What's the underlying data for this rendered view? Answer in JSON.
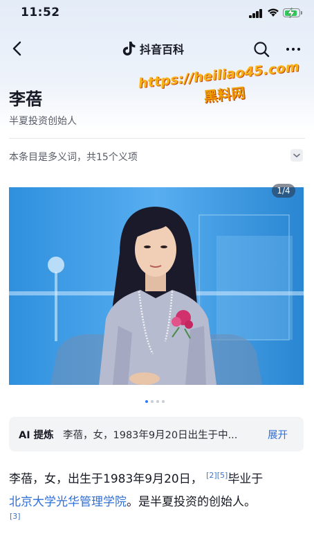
{
  "status_bar": {
    "time": "11:52"
  },
  "nav": {
    "brand_name": "抖音百科",
    "icons": [
      "back-icon",
      "douyin-logo-icon",
      "search-icon",
      "more-icon"
    ]
  },
  "entry": {
    "title": "李蓓",
    "subtitle": "半夏投资创始人"
  },
  "watermark": {
    "url": "https://heiliao45.com",
    "text": "黑料网"
  },
  "disambiguation": {
    "text": "本条目是多义词，共15个义项"
  },
  "gallery": {
    "counter": "1/4",
    "current": 1,
    "total": 4
  },
  "ai_summary": {
    "label": "AI 提炼",
    "text": "李蓓，女，1983年9月20日出生于中...",
    "expand_label": "展开"
  },
  "body": {
    "line1_text": "李蓓，女，出生于1983年9月20日，",
    "cite_2": "[2]",
    "cite_5": "[5]",
    "line1_tail": "毕业于",
    "link_text": "北京大学光华管理学院",
    "line2_tail": "。是半夏投资的创始人。",
    "cite_3": "[3]"
  },
  "colors": {
    "link": "#2e6fd8",
    "accent_dot": "#2e7df6",
    "battery": "#34c759"
  }
}
